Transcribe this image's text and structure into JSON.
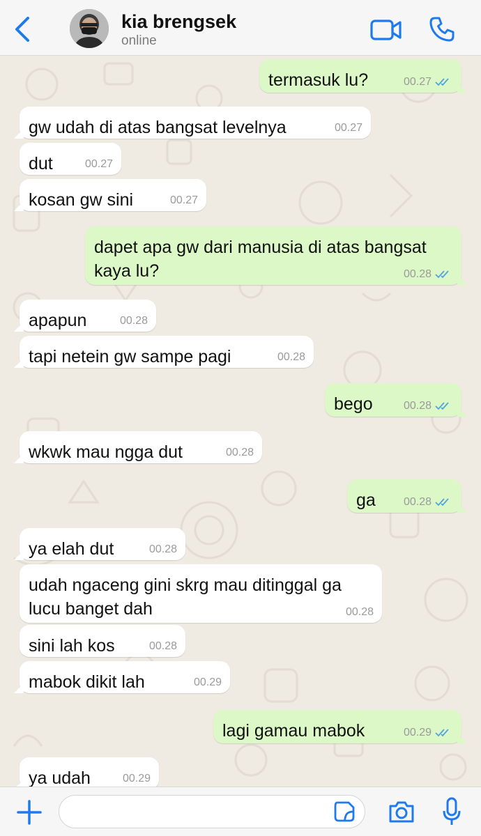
{
  "header": {
    "contact_name": "kia brengsek",
    "status": "online",
    "icons": [
      "chevron-left-icon",
      "video-camera-icon",
      "phone-icon"
    ]
  },
  "messages": [
    {
      "dir": "out",
      "text": "termasuk lu?",
      "time": "00.27",
      "read": true
    },
    {
      "dir": "in",
      "text": "gw udah di atas bangsat levelnya",
      "time": "00.27"
    },
    {
      "dir": "in",
      "text": "dut",
      "time": "00.27"
    },
    {
      "dir": "in",
      "text": "kosan gw sini",
      "time": "00.27"
    },
    {
      "dir": "out",
      "text": "dapet apa gw dari manusia di atas bangsat kaya lu?",
      "time": "00.28",
      "read": true
    },
    {
      "dir": "in",
      "text": "apapun",
      "time": "00.28"
    },
    {
      "dir": "in",
      "text": "tapi netein gw sampe pagi",
      "time": "00.28"
    },
    {
      "dir": "out",
      "text": "bego",
      "time": "00.28",
      "read": true
    },
    {
      "dir": "in",
      "text": "wkwk mau ngga dut",
      "time": "00.28"
    },
    {
      "dir": "out",
      "text": "ga",
      "time": "00.28",
      "read": true
    },
    {
      "dir": "in",
      "text": "ya elah dut",
      "time": "00.28"
    },
    {
      "dir": "in",
      "text": "udah ngaceng gini skrg mau ditinggal ga lucu banget dah",
      "time": "00.28"
    },
    {
      "dir": "in",
      "text": "sini lah kos",
      "time": "00.28"
    },
    {
      "dir": "in",
      "text": "mabok dikit lah",
      "time": "00.29"
    },
    {
      "dir": "out",
      "text": "lagi gamau mabok",
      "time": "00.29",
      "read": true
    },
    {
      "dir": "in",
      "text": "ya udah",
      "time": "00.29"
    }
  ],
  "composer": {
    "placeholder": "",
    "icons": [
      "plus-icon",
      "sticker-icon",
      "camera-icon",
      "microphone-icon"
    ]
  },
  "colors": {
    "accent": "#1f7aec",
    "outgoing_bubble": "#dcf8c6",
    "incoming_bubble": "#ffffff",
    "chat_background": "#efeae2",
    "read_tick": "#4fa3e0"
  }
}
